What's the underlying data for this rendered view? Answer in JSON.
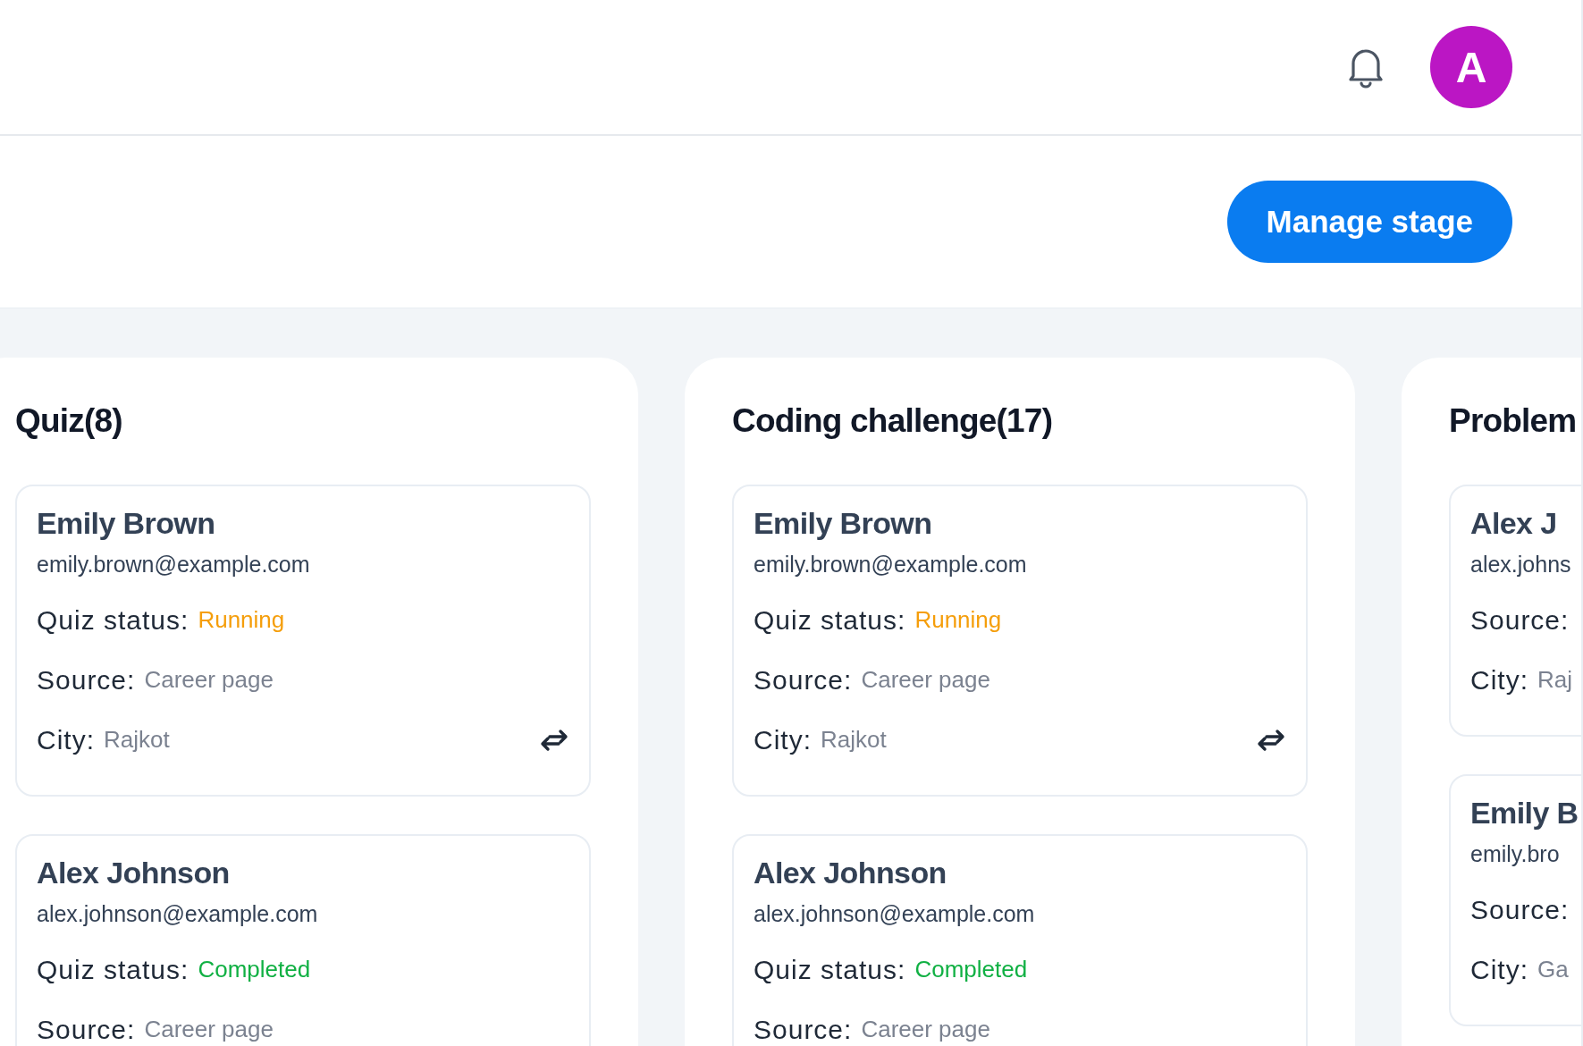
{
  "header": {
    "avatar_letter": "A"
  },
  "toolbar": {
    "button": "Manage stage"
  },
  "columns": [
    {
      "title": "Quiz(8)",
      "cards": [
        {
          "name": "Emily Brown",
          "email": "emily.brown@example.com",
          "move_icon": true,
          "fields": [
            {
              "label": "Quiz status:",
              "value": "Running",
              "kind": "running"
            },
            {
              "label": "Source:",
              "value": "Career page",
              "kind": "text"
            },
            {
              "label": "City:",
              "value": "Rajkot",
              "kind": "text"
            }
          ]
        },
        {
          "name": "Alex Johnson",
          "email": "alex.johnson@example.com",
          "fields": [
            {
              "label": "Quiz status:",
              "value": "Completed",
              "kind": "completed"
            },
            {
              "label": "Source:",
              "value": "Career page",
              "kind": "text"
            }
          ]
        }
      ]
    },
    {
      "title": "Coding challenge(17)",
      "cards": [
        {
          "name": "Emily Brown",
          "email": "emily.brown@example.com",
          "move_icon": true,
          "fields": [
            {
              "label": "Quiz status:",
              "value": "Running",
              "kind": "running"
            },
            {
              "label": "Source:",
              "value": "Career page",
              "kind": "text"
            },
            {
              "label": "City:",
              "value": "Rajkot",
              "kind": "text"
            }
          ]
        },
        {
          "name": "Alex Johnson",
          "email": "alex.johnson@example.com",
          "fields": [
            {
              "label": "Quiz status:",
              "value": "Completed",
              "kind": "completed"
            },
            {
              "label": "Source:",
              "value": "Career page",
              "kind": "text"
            }
          ]
        }
      ]
    },
    {
      "title": "Problem",
      "cards": [
        {
          "name": "Alex J",
          "email": "alex.johns",
          "fields": [
            {
              "label": "Source:"
            },
            {
              "label": "City:",
              "value": "Raj",
              "kind": "text"
            }
          ]
        },
        {
          "name": "Emily B",
          "email": "emily.bro",
          "fields": [
            {
              "label": "Source:"
            },
            {
              "label": "City:",
              "value": "Ga",
              "kind": "text"
            }
          ]
        }
      ]
    }
  ]
}
